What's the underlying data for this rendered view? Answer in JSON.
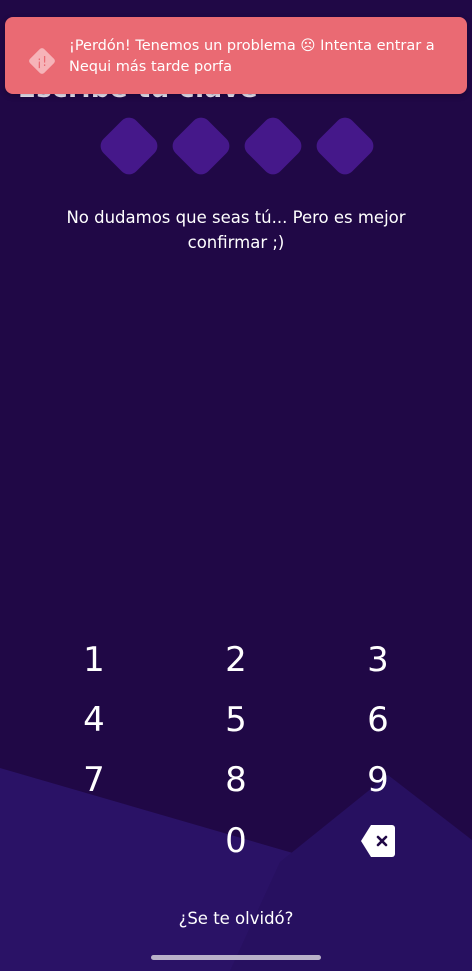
{
  "heading": "Escribe tu clave",
  "toast": {
    "icon": "alert-diamond-icon",
    "icon_glyph": "¡!",
    "message": "¡Perdón! Tenemos un problema ☹ Intenta entrar a Nequi más tarde porfa"
  },
  "pin": {
    "length": 4
  },
  "subtitle": "No dudamos que seas tú... Pero es mejor confirmar ;)",
  "keypad": {
    "keys": [
      "1",
      "2",
      "3",
      "4",
      "5",
      "6",
      "7",
      "8",
      "9",
      "0"
    ],
    "backspace_icon": "backspace-icon"
  },
  "forgot_link": "¿Se te olvidó?",
  "colors": {
    "background": "#200846",
    "toast": "#ea6a73",
    "pin_box": "#45188a",
    "accent_shape": "#2a1266"
  }
}
